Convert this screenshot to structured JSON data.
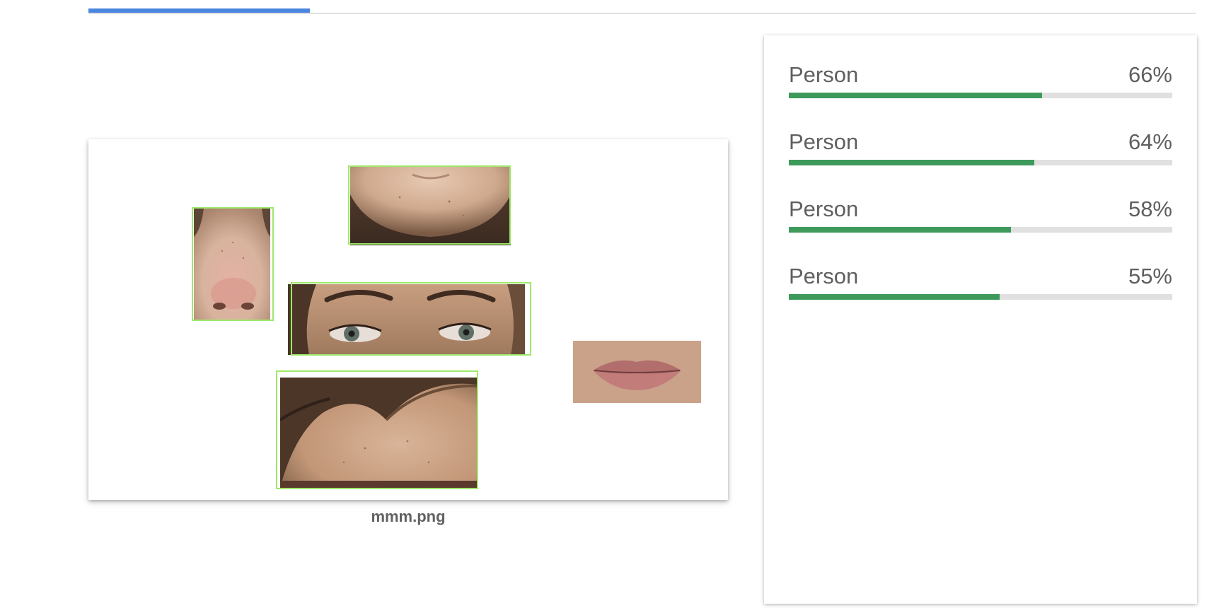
{
  "tabs": {
    "active_progress": 0.2
  },
  "image": {
    "file_name": "mmm.png",
    "crops": [
      {
        "name": "chin-crop",
        "depicts": "chin"
      },
      {
        "name": "nose-crop",
        "depicts": "nose"
      },
      {
        "name": "eyes-crop",
        "depicts": "eyes"
      },
      {
        "name": "lips-crop",
        "depicts": "lips"
      },
      {
        "name": "forehead-crop",
        "depicts": "forehead"
      }
    ],
    "bbox_color": "#9ee86a"
  },
  "results": [
    {
      "label": "Person",
      "percent": "66%",
      "score": 0.66
    },
    {
      "label": "Person",
      "percent": "64%",
      "score": 0.64
    },
    {
      "label": "Person",
      "percent": "58%",
      "score": 0.58
    },
    {
      "label": "Person",
      "percent": "55%",
      "score": 0.55
    }
  ],
  "colors": {
    "accent": "#4a86e0",
    "bar_fill": "#3d9a5b",
    "bar_track": "#e0e0e0"
  }
}
